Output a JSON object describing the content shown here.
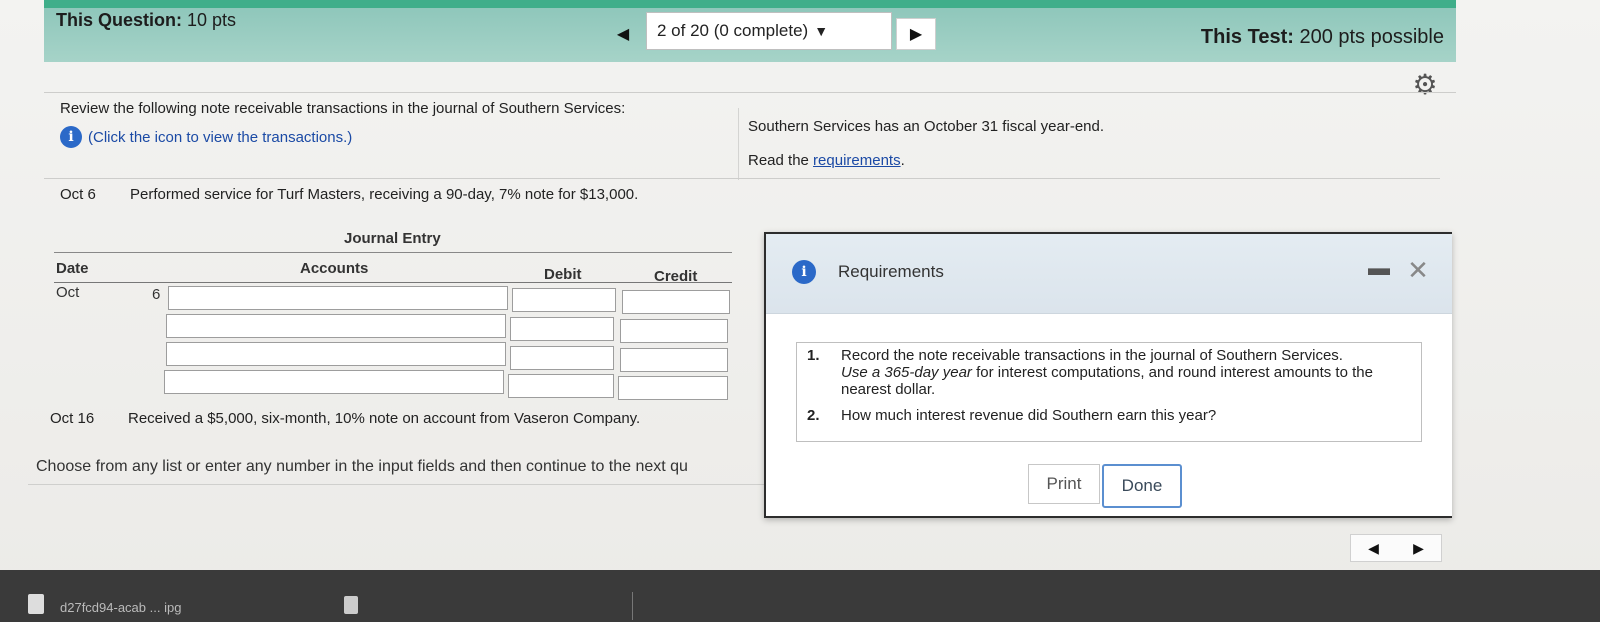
{
  "header": {
    "question_label": "This Question:",
    "question_points": "10 pts",
    "progress": "2 of 20 (0 complete)",
    "test_label": "This Test:",
    "test_points": "200 pts possible"
  },
  "intro": {
    "review_text": "Review the following note receivable transactions in the journal of Southern Services:",
    "click_text": "(Click the icon to view the transactions.)",
    "fiscal_text": "Southern Services has an October 31 fiscal year-end.",
    "read_prefix": "Read the ",
    "requirements_link": "requirements",
    "read_suffix": "."
  },
  "transactions": [
    {
      "date": "Oct 6",
      "text": "Performed service for Turf Masters, receiving a 90-day, 7% note for $13,000."
    },
    {
      "date": "Oct 16",
      "text": "Received a $5,000, six-month, 10% note on account from Vaseron Company."
    }
  ],
  "journal": {
    "title": "Journal Entry",
    "col_date": "Date",
    "col_accounts": "Accounts",
    "col_debit": "Debit",
    "col_credit": "Credit",
    "month": "Oct",
    "day": "6"
  },
  "footer_note": "Choose from any list or enter any number in the input fields and then continue to the next qu",
  "modal": {
    "title": "Requirements",
    "minimize_icon": "minimize-icon",
    "close_icon": "close-icon",
    "req1_num": "1.",
    "req1_line1": "Record the note receivable transactions in the journal of Southern Services.",
    "req1_italic": "Use a 365-day year",
    "req1_rest": " for interest computations, and round interest amounts to the nearest dollar.",
    "req2_num": "2.",
    "req2_text": "How much interest revenue did Southern earn this year?",
    "print_label": "Print",
    "done_label": "Done"
  },
  "taskbar": {
    "file_label": "d27fcd94-acab ... ipg"
  },
  "colors": {
    "header": "#a6d3c8",
    "accent": "#3fae8a",
    "link": "#1b4aa5",
    "info": "#2b69c8"
  }
}
